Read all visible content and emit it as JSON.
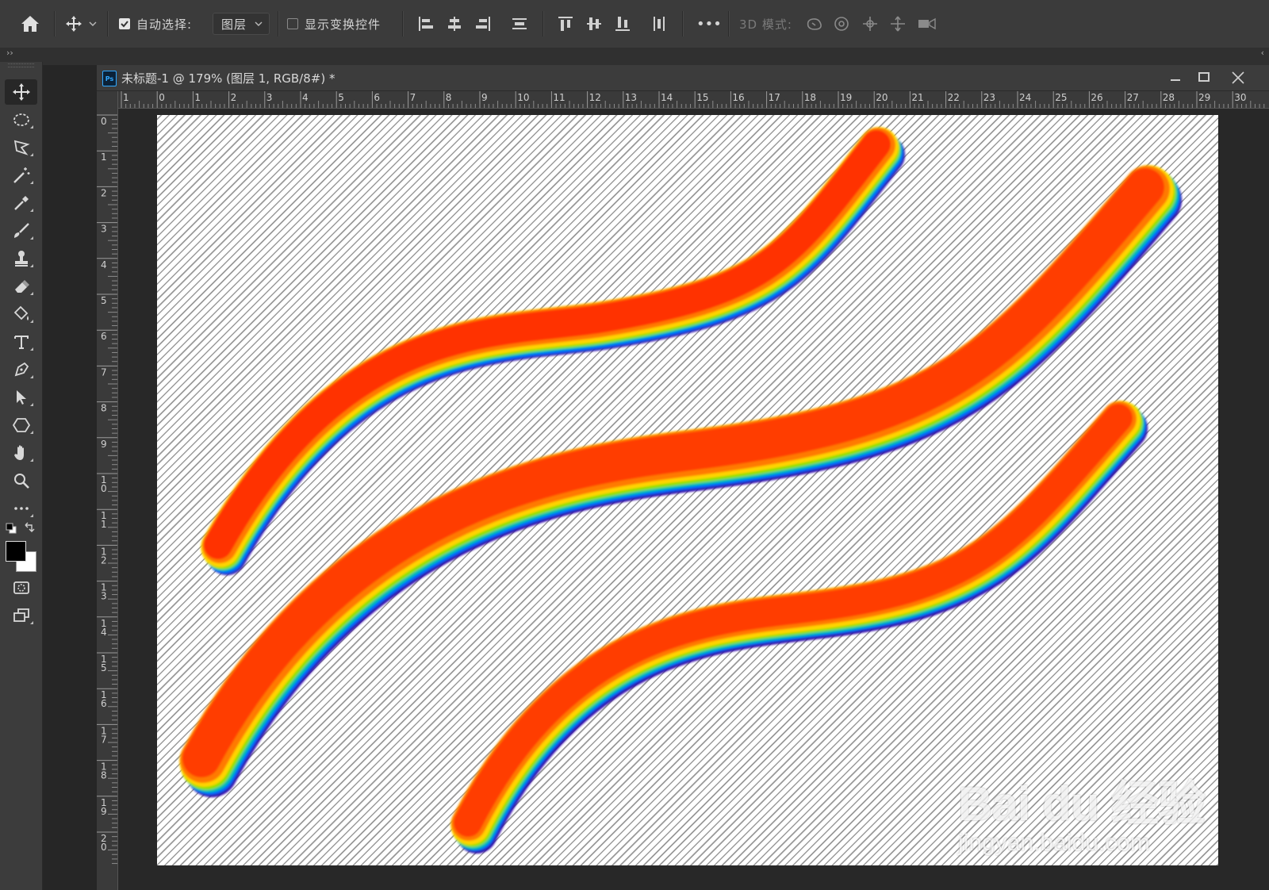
{
  "options_bar": {
    "home_icon": "home-icon",
    "move_tool_icon": "move-icon",
    "auto_select_checked": true,
    "auto_select_label": "自动选择:",
    "auto_select_target": "图层",
    "show_transform_checked": false,
    "show_transform_label": "显示变换控件",
    "more_label": "•••",
    "mode_3d_label": "3D 模式:"
  },
  "document": {
    "tab_title": "未标题-1 @ 179% (图层 1, RGB/8#) *",
    "ps_badge": "Ps",
    "ruler_h_labels": [
      "1",
      "0",
      "1",
      "2",
      "3",
      "4",
      "5",
      "6",
      "7",
      "8",
      "9",
      "10",
      "11",
      "12",
      "13",
      "14",
      "15",
      "16",
      "17",
      "18",
      "19",
      "20",
      "21",
      "22",
      "23",
      "24",
      "25",
      "26",
      "27",
      "28",
      "29",
      "30"
    ],
    "ruler_v_labels": [
      "0",
      "1",
      "2",
      "3",
      "4",
      "5",
      "6",
      "7",
      "8",
      "9",
      "1\n0",
      "1\n1",
      "1\n2",
      "1\n3",
      "1\n4",
      "1\n5",
      "1\n6",
      "1\n7",
      "1\n8",
      "1\n9",
      "2\n0"
    ]
  },
  "toolbar": {
    "tools": [
      "move-tool",
      "marquee-tool",
      "lasso-tool",
      "magic-wand-tool",
      "eyedropper-tool",
      "brush-tool",
      "stamp-tool",
      "eraser-tool",
      "smudge-tool",
      "type-tool",
      "pen-tool",
      "path-select-tool",
      "shape-tool",
      "hand-tool",
      "zoom-tool",
      "more-tools"
    ],
    "foreground_color": "#000000",
    "background_color": "#ffffff"
  },
  "watermark": {
    "brand": "Bai du 经验",
    "url": "jingyan.baidu.com"
  }
}
